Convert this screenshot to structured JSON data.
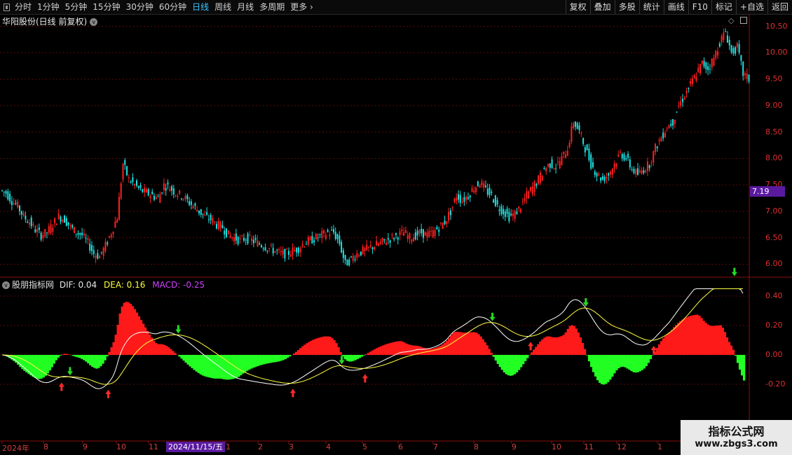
{
  "toolbar": {
    "periods": [
      "分时",
      "1分钟",
      "5分钟",
      "15分钟",
      "30分钟",
      "60分钟",
      "日线",
      "周线",
      "月线",
      "多周期",
      "更多"
    ],
    "active_period": "日线",
    "actions": [
      "复权",
      "叠加",
      "多股",
      "统计",
      "画线",
      "F10",
      "标记",
      "+自选",
      "返回"
    ]
  },
  "main_pane": {
    "title": "华阳股份(日线 前复权)",
    "price_axis": [
      "10.50",
      "10.00",
      "9.50",
      "9.00",
      "8.50",
      "8.00",
      "7.50",
      "7.00",
      "6.50",
      "6.00"
    ],
    "current_price": "7.19"
  },
  "indicator_pane": {
    "name": "股朋指标网",
    "dif_label": "DIF: 0.04",
    "dea_label": "DEA: 0.16",
    "macd_label": "MACD: -0.25",
    "axis": [
      "0.40",
      "0.20",
      "0.00",
      "-0.20"
    ]
  },
  "date_axis": {
    "labels": [
      "2024年",
      "8",
      "9",
      "10",
      "11",
      "2024/11/15/五",
      "1",
      "2",
      "3",
      "4",
      "5",
      "6",
      "7",
      "8",
      "9",
      "10",
      "11",
      "12",
      "1"
    ],
    "cursor_date": "2024/11/15/五"
  },
  "watermark": {
    "line1": "指标公式网",
    "line2": "www.zbgs3.com"
  },
  "colors": {
    "up": "#ff2020",
    "down": "#20e0e0",
    "macd_pos": "#ff1a1a",
    "macd_neg": "#22ff22",
    "dif": "#ffffff",
    "dea": "#ffff40",
    "accent": "#39c8ff"
  },
  "chart_data": {
    "type": "candlestick",
    "price_range": [
      5.9,
      10.6
    ],
    "close_path": [
      7.35,
      7.2,
      7.1,
      6.9,
      6.8,
      6.65,
      6.55,
      6.6,
      6.75,
      6.9,
      6.85,
      6.7,
      6.6,
      6.55,
      6.4,
      6.2,
      6.15,
      6.35,
      6.6,
      6.9,
      7.9,
      7.6,
      7.5,
      7.4,
      7.35,
      7.3,
      7.25,
      7.5,
      7.45,
      7.35,
      7.3,
      7.2,
      7.1,
      7.0,
      6.9,
      6.85,
      6.75,
      6.7,
      6.55,
      6.5,
      6.45,
      6.5,
      6.45,
      6.4,
      6.35,
      6.3,
      6.25,
      6.2,
      6.2,
      6.25,
      6.3,
      6.4,
      6.45,
      6.5,
      6.55,
      6.6,
      6.6,
      6.4,
      6.0,
      6.1,
      6.2,
      6.25,
      6.3,
      6.35,
      6.4,
      6.45,
      6.5,
      6.55,
      6.6,
      6.5,
      6.55,
      6.6,
      6.55,
      6.6,
      6.7,
      6.8,
      7.0,
      7.3,
      7.2,
      7.3,
      7.45,
      7.55,
      7.4,
      7.3,
      7.1,
      7.0,
      6.9,
      6.95,
      7.1,
      7.3,
      7.45,
      7.6,
      7.8,
      7.9,
      7.85,
      8.0,
      8.2,
      8.7,
      8.5,
      8.2,
      7.9,
      7.7,
      7.6,
      7.7,
      7.9,
      8.1,
      8.0,
      7.8,
      7.7,
      7.8,
      7.9,
      8.2,
      8.4,
      8.6,
      8.7,
      9.0,
      9.2,
      9.4,
      9.6,
      9.8,
      9.7,
      9.9,
      10.2,
      10.4,
      10.0,
      10.1,
      9.6,
      9.5
    ]
  }
}
